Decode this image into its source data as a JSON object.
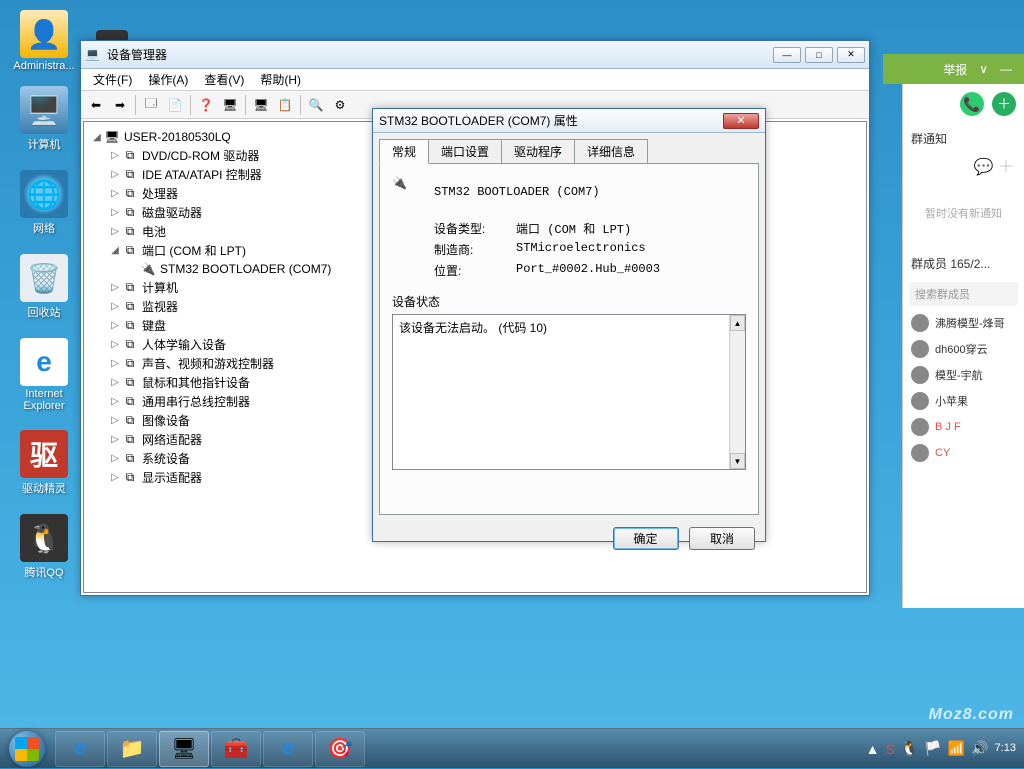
{
  "desktop": {
    "icons": [
      {
        "label": "Administra...",
        "ico": "ico-folder"
      },
      {
        "label": "计算机",
        "ico": "ico-computer"
      },
      {
        "label": "网络",
        "ico": "ico-network"
      },
      {
        "label": "回收站",
        "ico": "ico-recycle"
      },
      {
        "label": "Internet Explorer",
        "ico": "ico-ie"
      },
      {
        "label": "驱动精灵",
        "ico": "ico-red",
        "glyph": "驱"
      },
      {
        "label": "腾讯QQ",
        "ico": "ico-qq"
      }
    ]
  },
  "devmgr": {
    "title": "设备管理器",
    "menu": [
      "文件(F)",
      "操作(A)",
      "查看(V)",
      "帮助(H)"
    ],
    "root": "USER-20180530LQ",
    "nodes": [
      {
        "label": "DVD/CD-ROM 驱动器",
        "exp": "▷"
      },
      {
        "label": "IDE ATA/ATAPI 控制器",
        "exp": "▷"
      },
      {
        "label": "处理器",
        "exp": "▷"
      },
      {
        "label": "磁盘驱动器",
        "exp": "▷"
      },
      {
        "label": "电池",
        "exp": "▷"
      },
      {
        "label": "端口 (COM 和 LPT)",
        "exp": "◢",
        "children": [
          {
            "label": "STM32  BOOTLOADER (COM7)"
          }
        ]
      },
      {
        "label": "计算机",
        "exp": "▷"
      },
      {
        "label": "监视器",
        "exp": "▷"
      },
      {
        "label": "键盘",
        "exp": "▷"
      },
      {
        "label": "人体学输入设备",
        "exp": "▷"
      },
      {
        "label": "声音、视频和游戏控制器",
        "exp": "▷"
      },
      {
        "label": "鼠标和其他指针设备",
        "exp": "▷"
      },
      {
        "label": "通用串行总线控制器",
        "exp": "▷"
      },
      {
        "label": "图像设备",
        "exp": "▷"
      },
      {
        "label": "网络适配器",
        "exp": "▷"
      },
      {
        "label": "系统设备",
        "exp": "▷"
      },
      {
        "label": "显示适配器",
        "exp": "▷"
      }
    ]
  },
  "props": {
    "title": "STM32  BOOTLOADER (COM7) 属性",
    "tabs": [
      "常规",
      "端口设置",
      "驱动程序",
      "详细信息"
    ],
    "device_name": "STM32  BOOTLOADER (COM7)",
    "kv": {
      "type_k": "设备类型:",
      "type_v": "端口 (COM 和 LPT)",
      "mfg_k": "制造商:",
      "mfg_v": "STMicroelectronics",
      "loc_k": "位置:",
      "loc_v": "Port_#0002.Hub_#0003"
    },
    "status_label": "设备状态",
    "status_text": "该设备无法启动。 (代码 10)",
    "ok": "确定",
    "cancel": "取消"
  },
  "qq": {
    "topbar": {
      "report": "举报",
      "down": "∨",
      "min": "—"
    },
    "notif_header": "群通知",
    "empty": "暂时没有新通知",
    "members_header": "群成员 165/2...",
    "search_placeholder": "搜索群成员",
    "members": [
      {
        "name": "沸腾模型-烽哥",
        "red": false
      },
      {
        "name": "dh600穿云",
        "red": false
      },
      {
        "name": "模型-宇航",
        "red": false
      },
      {
        "name": "小苹果",
        "red": false
      },
      {
        "name": "B J F",
        "red": true
      },
      {
        "name": "CY",
        "red": true
      }
    ]
  },
  "taskbar": {
    "time": "7:13"
  },
  "watermark": "Moz8.com"
}
